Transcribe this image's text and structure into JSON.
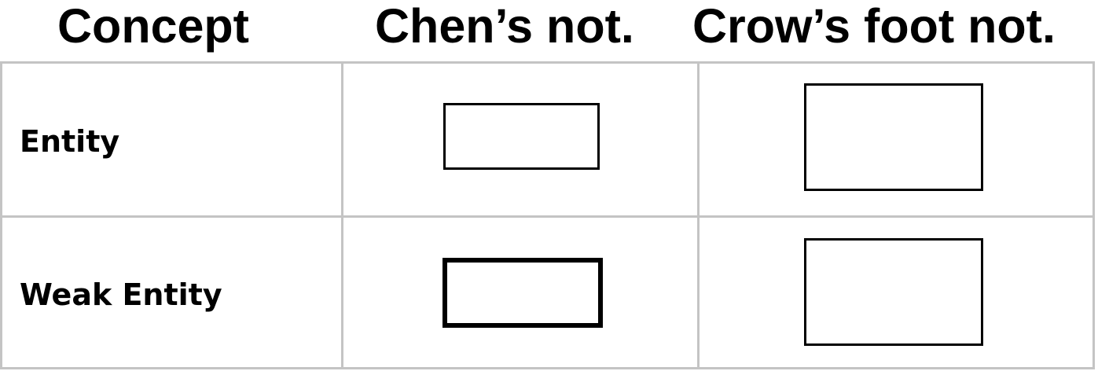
{
  "headers": {
    "concept": "Concept",
    "chen": "Chen’s not.",
    "crow": "Crow’s foot not."
  },
  "rows": [
    {
      "concept": "Entity",
      "chen_symbol": "rectangle",
      "crow_symbol": "rectangle"
    },
    {
      "concept": "Weak Entity",
      "chen_symbol": "rectangle-thick-border",
      "crow_symbol": "rectangle"
    }
  ],
  "colors": {
    "grid": "#c4c4c4",
    "stroke": "#000000",
    "background": "#ffffff"
  }
}
